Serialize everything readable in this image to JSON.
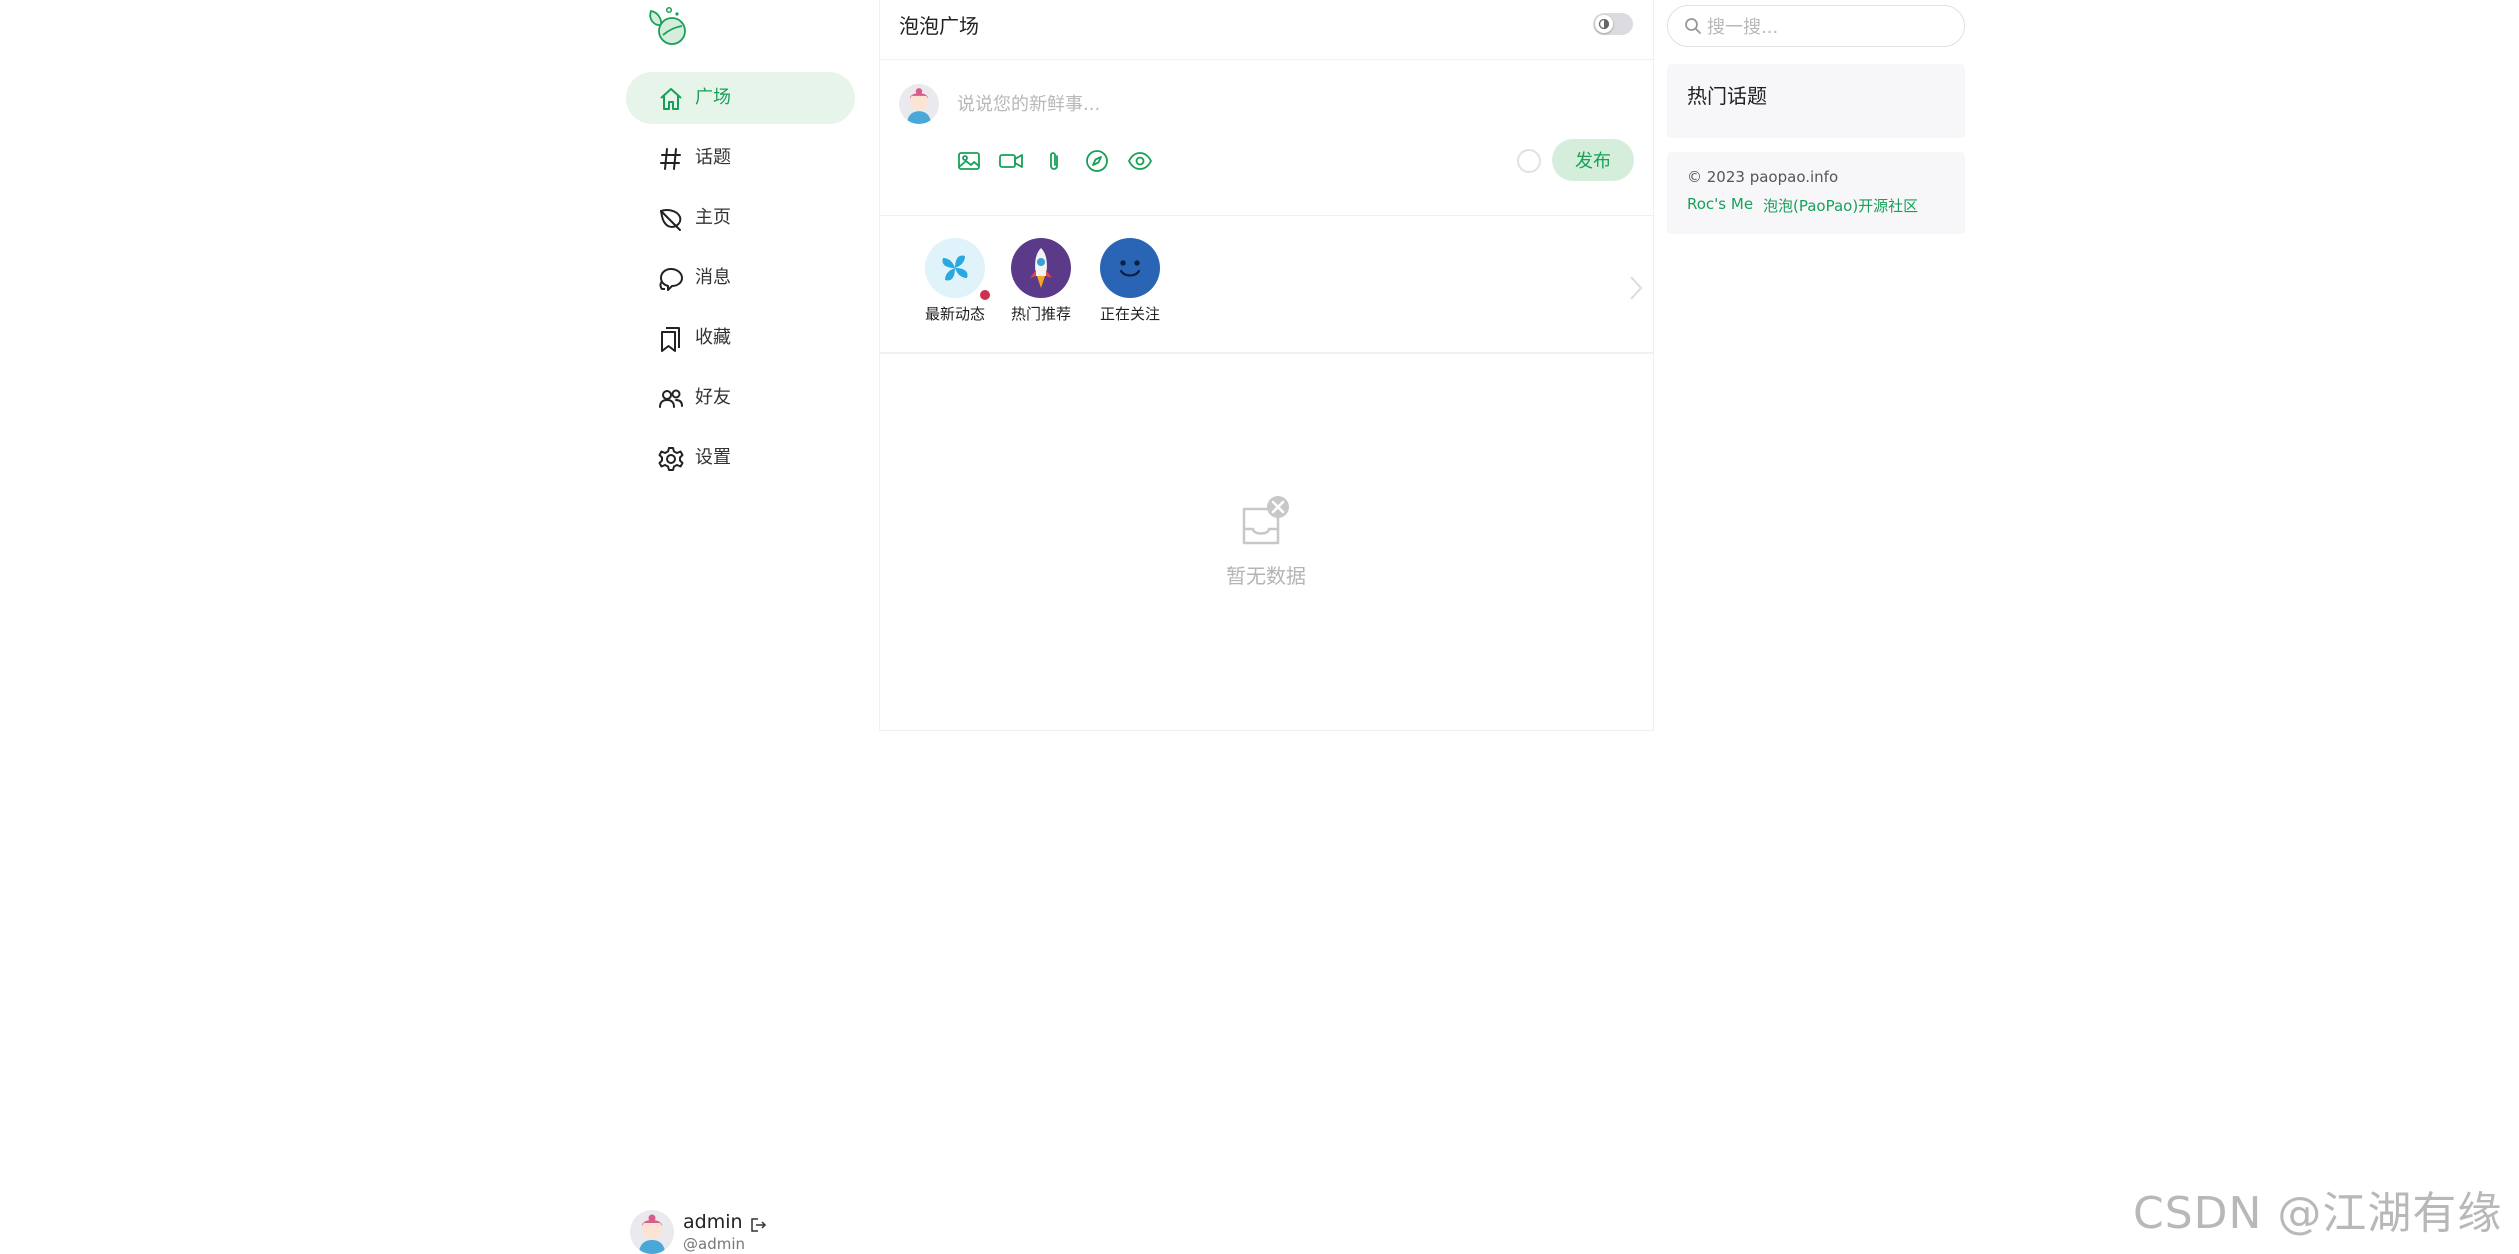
{
  "sidebar": {
    "items": [
      {
        "label": "广场",
        "icon": "home-icon",
        "active": true
      },
      {
        "label": "话题",
        "icon": "hash-icon"
      },
      {
        "label": "主页",
        "icon": "leaf-icon"
      },
      {
        "label": "消息",
        "icon": "chat-bubbles-icon"
      },
      {
        "label": "收藏",
        "icon": "bookmark-icon"
      },
      {
        "label": "好友",
        "icon": "people-icon"
      },
      {
        "label": "设置",
        "icon": "gear-icon"
      }
    ],
    "user": {
      "name": "admin",
      "handle": "@admin"
    }
  },
  "header": {
    "title": "泡泡广场"
  },
  "composer": {
    "placeholder": "说说您的新鲜事...",
    "tools": [
      "image-icon",
      "video-icon",
      "attachment-icon",
      "compass-icon",
      "eye-icon"
    ],
    "publish_label": "发布"
  },
  "tabs": [
    {
      "label": "最新动态",
      "icon": "pinwheel-icon",
      "has_new": true
    },
    {
      "label": "热门推荐",
      "icon": "rocket-icon"
    },
    {
      "label": "正在关注",
      "icon": "smile-icon"
    }
  ],
  "feed": {
    "empty_text": "暂无数据"
  },
  "search": {
    "placeholder": "搜一搜..."
  },
  "hot_topics": {
    "title": "热门话题"
  },
  "footer": {
    "copyright": "© 2023 paopao.info",
    "links": [
      "Roc's Me",
      "泡泡(PaoPao)开源社区"
    ]
  },
  "watermark": "CSDN @江湖有缘",
  "colors": {
    "accent": "#18a058",
    "active_bg": "#e6f4ea",
    "publish_bg": "#d4eedb",
    "badge": "#d03050"
  }
}
